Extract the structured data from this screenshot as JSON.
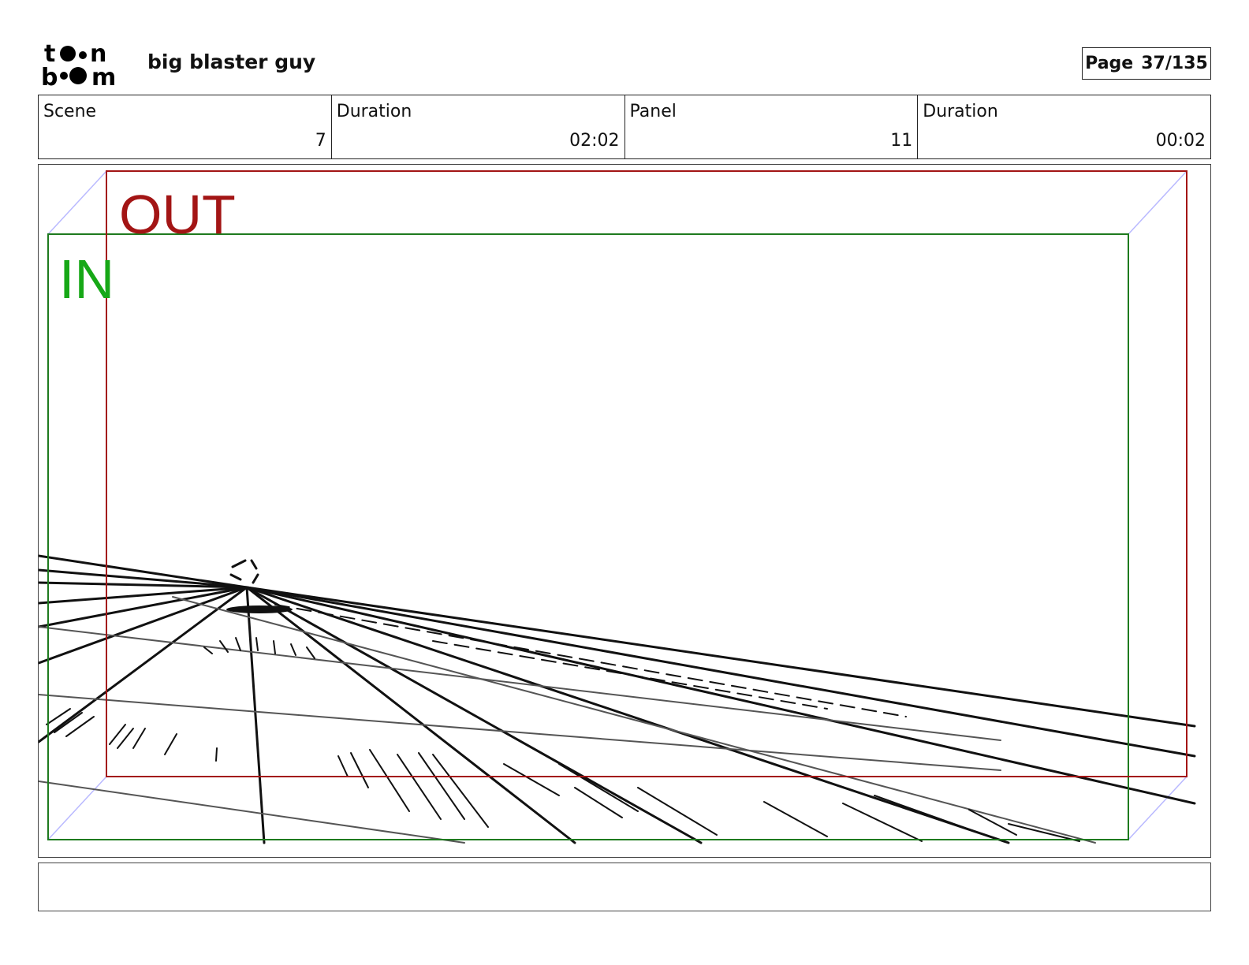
{
  "header": {
    "logo_text": "toonboom",
    "project_title": "big blaster guy",
    "page_label": "Page",
    "page_value": "37/135"
  },
  "info": {
    "scene_label": "Scene",
    "scene_value": "7",
    "scene_duration_label": "Duration",
    "scene_duration_value": "02:02",
    "panel_label": "Panel",
    "panel_value": "11",
    "panel_duration_label": "Duration",
    "panel_duration_value": "00:02"
  },
  "panel": {
    "out_label": "OUT",
    "in_label": "IN",
    "colors": {
      "out_frame": "#a31515",
      "in_frame": "#1e7a1e",
      "in_text": "#17a817",
      "guide": "#b9b9ff"
    }
  },
  "notes": {
    "text": ""
  }
}
